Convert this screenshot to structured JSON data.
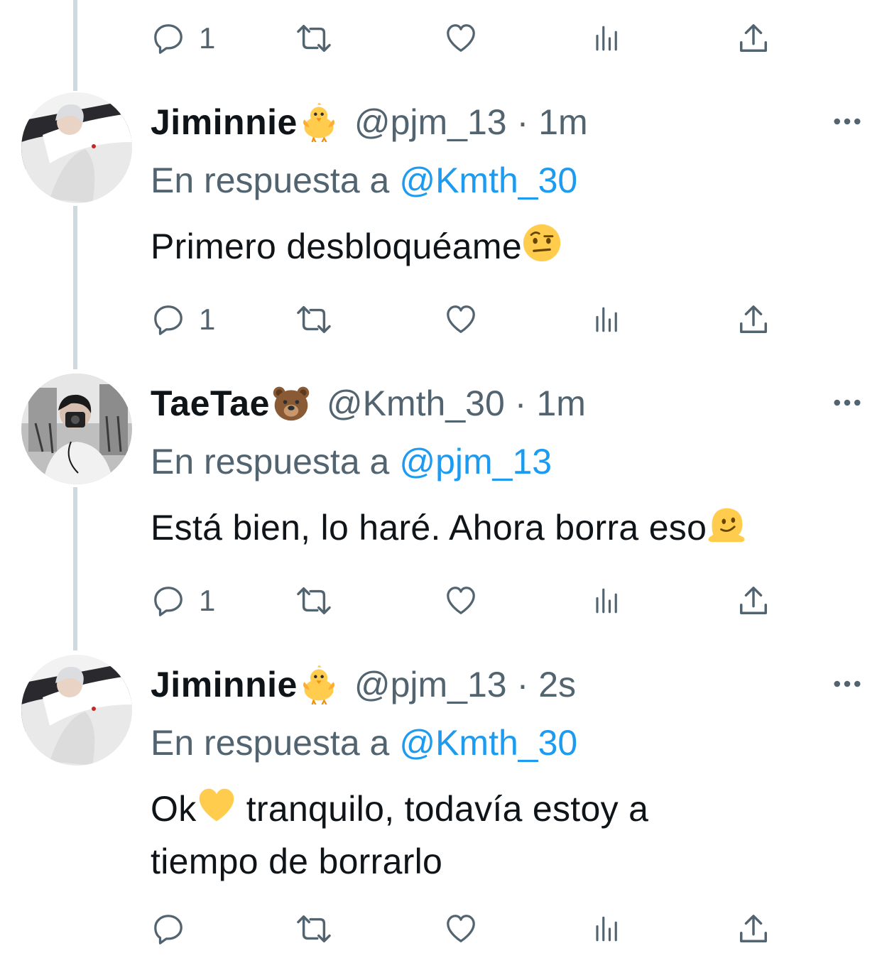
{
  "thread": {
    "top_actions": {
      "reply_count": "1"
    },
    "tweets": [
      {
        "name": "Jiminnie",
        "name_emoji": "baby-chick",
        "handle": "@pjm_13",
        "separator": "·",
        "time": "1m",
        "reply_prefix": "En respuesta a",
        "reply_to": "@Kmth_30",
        "text": "Primero desbloquéame",
        "text_emoji": "face-with-raised-eyebrow",
        "reply_count": "1"
      },
      {
        "name": "TaeTae",
        "name_emoji": "bear-face",
        "handle": "@Kmth_30",
        "separator": "·",
        "time": "1m",
        "reply_prefix": "En respuesta a",
        "reply_to": "@pjm_13",
        "text": "Está bien, lo haré. Ahora borra eso",
        "text_emoji": "melting-face",
        "reply_count": "1"
      },
      {
        "name": "Jiminnie",
        "name_emoji": "baby-chick",
        "handle": "@pjm_13",
        "separator": "·",
        "time": "2s",
        "reply_prefix": "En respuesta a",
        "reply_to": "@Kmth_30",
        "text_before_emoji": "Ok",
        "text_emoji": "yellow-heart",
        "text_after_emoji": " tranquilo, todavía estoy a tiempo de borrarlo",
        "reply_count": ""
      }
    ]
  },
  "colors": {
    "primary_text": "#0f1419",
    "secondary_text": "#536471",
    "link": "#1d9bf0",
    "thread_line": "#cfd9de"
  },
  "icons": [
    "reply-icon",
    "retweet-icon",
    "like-icon",
    "views-icon",
    "share-icon",
    "more-icon"
  ]
}
